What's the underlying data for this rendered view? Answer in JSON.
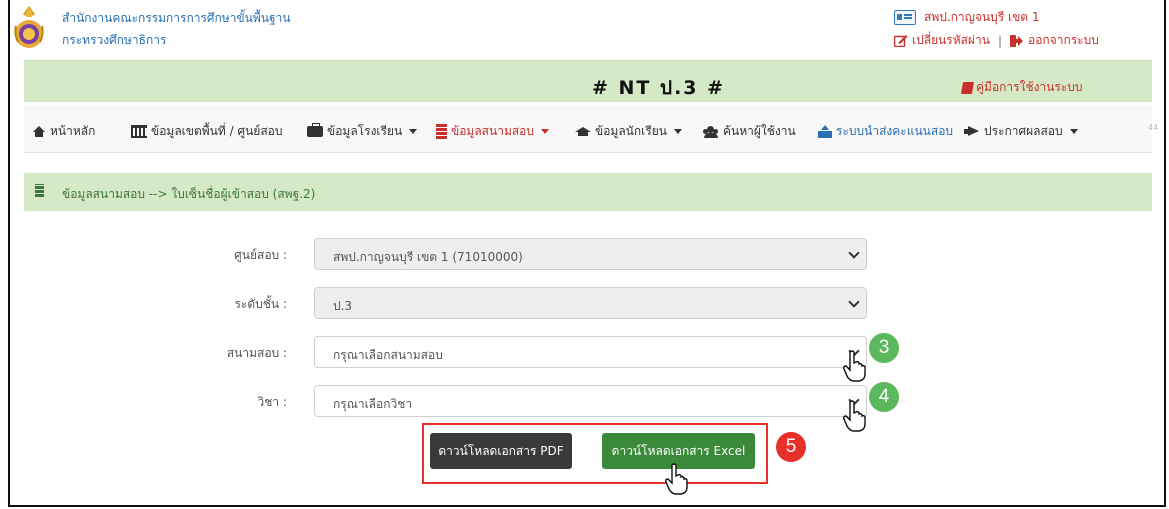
{
  "header": {
    "org_line1": "สำนักงานคณะกรรมการการศึกษาขั้นพื้นฐาน",
    "org_line2": "กระทรวงศึกษาธิการ",
    "user_name": "สพป.กาญจนบุรี เขต 1",
    "change_password": "เปลี่ยนรหัสผ่าน",
    "separator": "|",
    "logout": "ออกจากระบบ"
  },
  "banner": {
    "title": "# NT ป.3 #",
    "manual_link": "คู่มือการใช้งานระบบ"
  },
  "nav": {
    "items": [
      {
        "label": "หน้าหลัก",
        "icon": "home-icon"
      },
      {
        "label": "ข้อมูลเขตพื้นที่ / ศูนย์สอบ",
        "icon": "bank-icon"
      },
      {
        "label": "ข้อมูลโรงเรียน",
        "icon": "briefcase-icon"
      },
      {
        "label": "ข้อมูลสนามสอบ",
        "icon": "building-icon"
      },
      {
        "label": "ข้อมูลนักเรียน",
        "icon": "graduation-cap-icon"
      },
      {
        "label": "ค้นหาผู้ใช้งาน",
        "icon": "users-icon"
      },
      {
        "label": "ระบบนำส่งคะแนนสอบ",
        "icon": "upload-icon"
      },
      {
        "label": "ประกาศผลสอบ",
        "icon": "bullhorn-icon"
      }
    ],
    "overflow_text": "44"
  },
  "breadcrumb": {
    "text": "ข้อมูลสนามสอบ --> ใบเซ็นชื่อผู้เข้าสอบ (สพฐ.2)"
  },
  "form": {
    "center_label": "ศูนย์สอบ :",
    "center_value": "สพป.กาญจนบุรี เขต 1 (71010000)",
    "level_label": "ระดับชั้น :",
    "level_value": "ป.3",
    "site_label": "สนามสอบ :",
    "site_value": "กรุณาเลือกสนามสอบ",
    "subject_label": "วิชา :",
    "subject_value": "กรุณาเลือกวิชา"
  },
  "buttons": {
    "pdf": "ดาวน์โหลดเอกสาร PDF",
    "excel": "ดาวน์โหลดเอกสาร Excel"
  },
  "annotations": {
    "step3": "3",
    "step4": "4",
    "step5": "5"
  },
  "colors": {
    "banner_bg": "#d6e9c6",
    "accent_red": "#c9302c",
    "link_blue": "#2a6fb0",
    "excel_green": "#3a8a39",
    "pdf_dark": "#3a3a3a",
    "badge_green": "#5cb85c",
    "badge_red": "#e8302a"
  }
}
